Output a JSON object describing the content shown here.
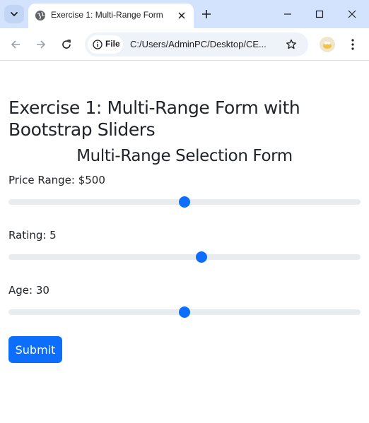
{
  "browser": {
    "tab_title": "Exercise 1: Multi-Range Form",
    "site_chip_label": "File",
    "url": "C:/Users/AdminPC/Desktop/CE..."
  },
  "page": {
    "heading": "Exercise 1: Multi-Range Form with Bootstrap Sliders",
    "subheading": "Multi-Range Selection Form",
    "fields": [
      {
        "label": "Price Range: $500",
        "fraction": 0.5
      },
      {
        "label": "Rating: 5",
        "fraction": 0.55
      },
      {
        "label": "Age: 30",
        "fraction": 0.5
      }
    ],
    "submit_label": "Submit"
  },
  "colors": {
    "tabstrip": "#d3e3fd",
    "primary": "#0d6efd",
    "track": "#e9ecef"
  }
}
